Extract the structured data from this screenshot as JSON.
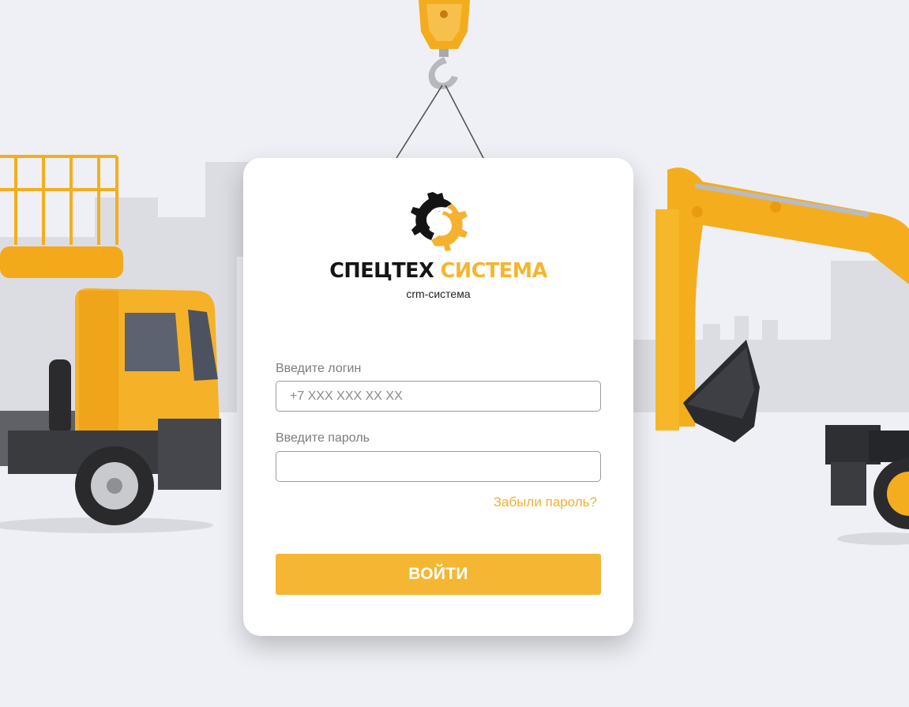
{
  "brand": {
    "name_part1": "СПЕЦТЕХ",
    "name_part2": "СИСТЕМА",
    "subtitle": "crm-система",
    "logo_icon": "gear-s-logo-icon"
  },
  "form": {
    "login_label": "Введите логин",
    "login_placeholder": "+7 XXX XXX XX XX",
    "login_value": "",
    "password_label": "Введите пароль",
    "password_value": "",
    "forgot_link": "Забыли пароль?",
    "submit_label": "ВОЙТИ"
  },
  "colors": {
    "accent": "#f5b733",
    "background": "#eff0f5",
    "card": "#ffffff",
    "brand_dark": "#151515"
  }
}
